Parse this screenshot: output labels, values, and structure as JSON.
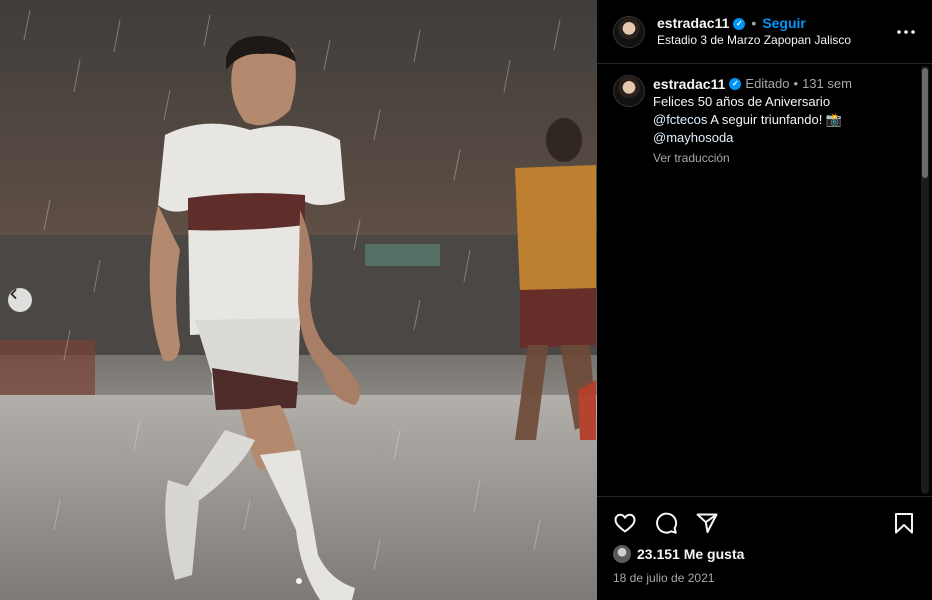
{
  "post": {
    "username": "estradac11",
    "follow_label": "Seguir",
    "location": "Estadio 3 de Marzo Zapopan Jalisco",
    "separator": "•"
  },
  "caption": {
    "username": "estradac11",
    "edited": "Editado",
    "separator": "•",
    "time_ago": "131 sem",
    "text_1": "Felices 50 años de Aniversario",
    "mention_1": "@fctecos",
    "text_2": " A seguir triunfando! 📸",
    "mention_2": "@mayhosoda",
    "translate_label": "Ver traducción"
  },
  "engagement": {
    "likes": "23.151 Me gusta",
    "date": "18 de julio de 2021"
  },
  "icons": {
    "more": "more-horizontal-icon",
    "like": "heart-icon",
    "comment": "comment-icon",
    "share": "share-icon",
    "save": "bookmark-icon",
    "carousel_prev": "chevron-left-icon"
  },
  "colors": {
    "accent": "#0095f6",
    "background": "#000000",
    "muted_text": "#a8a8a8"
  },
  "carousel": {
    "total_slides": 1,
    "active_slide": 1
  }
}
